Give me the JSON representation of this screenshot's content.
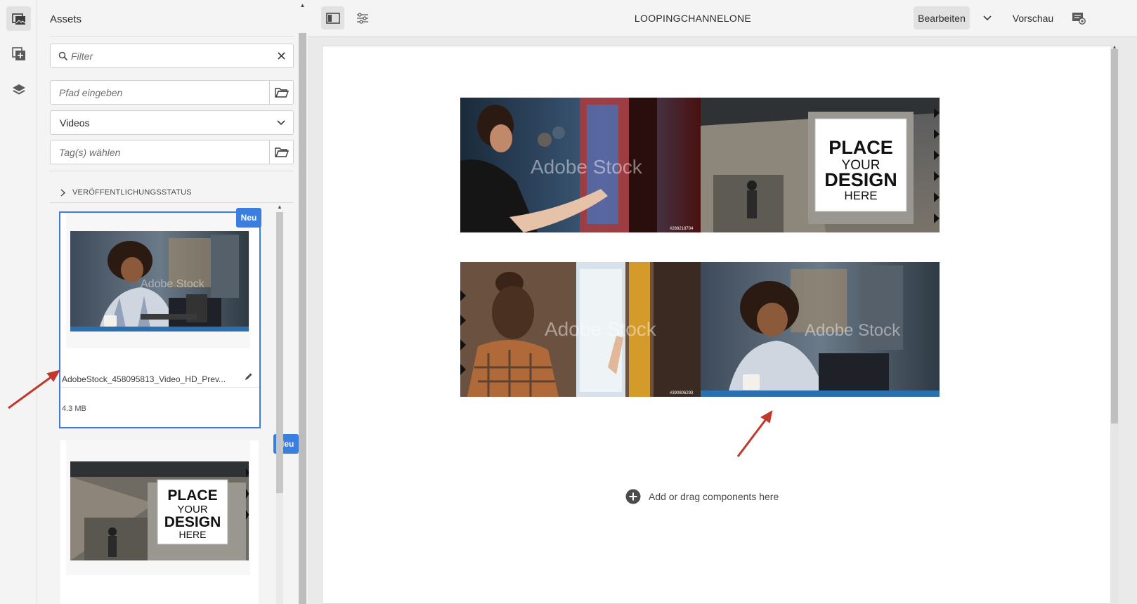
{
  "panel": {
    "title": "Assets",
    "filter_placeholder": "Filter",
    "path_placeholder": "Pfad eingeben",
    "type_value": "Videos",
    "tags_placeholder": "Tag(s) wählen",
    "publish_status_label": "VERÖFFENTLICHUNGSSTATUS"
  },
  "assets": [
    {
      "badge": "Neu",
      "name": "AdobeStock_458095813_Video_HD_Prev...",
      "size": "4.3 MB",
      "watermark": "Adobe Stock"
    },
    {
      "badge": "Neu",
      "thumb_lines": [
        "PLACE",
        "YOUR",
        "DESIGN",
        "HERE"
      ]
    }
  ],
  "topbar": {
    "page_title": "LOOPINGCHANNELONE",
    "edit_label": "Bearbeiten",
    "preview_label": "Vorschau"
  },
  "canvas": {
    "banner1": {
      "watermark": "Adobe Stock",
      "stock_id": "#288218704",
      "sign_lines": [
        "PLACE",
        "YOUR",
        "DESIGN",
        "HERE"
      ]
    },
    "banner2": {
      "watermark_left": "Adobe Stock",
      "watermark_right": "Adobe Stock",
      "stock_id": "#390806293"
    },
    "drop_zone_label": "Add or drag components here"
  },
  "colors": {
    "accent": "#3a7fe0",
    "annotation_arrow": "#c0392b"
  }
}
